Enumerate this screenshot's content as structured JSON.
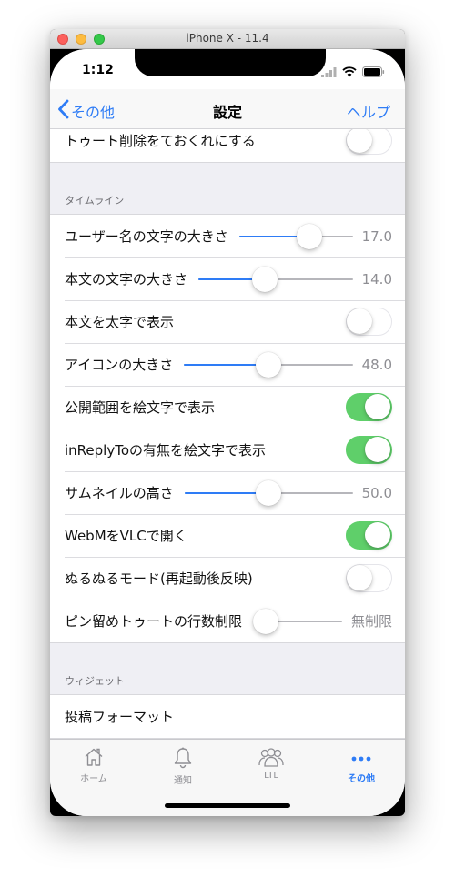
{
  "window": {
    "title": "iPhone X - 11.4"
  },
  "status": {
    "time": "1:12"
  },
  "nav": {
    "back_label": "その他",
    "title": "設定",
    "help_label": "ヘルプ"
  },
  "top_row": {
    "label": "トゥート削除をておくれにする",
    "on": false
  },
  "timeline": {
    "header": "タイムライン",
    "rows": [
      {
        "label": "ユーザー名の文字の大きさ",
        "type": "slider",
        "value": "17.0",
        "fraction": 0.65
      },
      {
        "label": "本文の文字の大きさ",
        "type": "slider",
        "value": "14.0",
        "fraction": 0.42
      },
      {
        "label": "本文を太字で表示",
        "type": "toggle",
        "on": false
      },
      {
        "label": "アイコンの大きさ",
        "type": "slider",
        "value": "48.0",
        "fraction": 0.5
      },
      {
        "label": "公開範囲を絵文字で表示",
        "type": "toggle",
        "on": true
      },
      {
        "label": "inReplyToの有無を絵文字で表示",
        "type": "toggle",
        "on": true
      },
      {
        "label": "サムネイルの高さ",
        "type": "slider",
        "value": "50.0",
        "fraction": 0.5
      },
      {
        "label": "WebMをVLCで開く",
        "type": "toggle",
        "on": true
      },
      {
        "label": "ぬるぬるモード(再起動後反映)",
        "type": "toggle",
        "on": false
      },
      {
        "label": "ピン留めトゥートの行数制限",
        "type": "slider",
        "value": "無制限",
        "fraction": 0.0
      }
    ]
  },
  "widget": {
    "header": "ウィジェット",
    "rows": [
      {
        "label": "投稿フォーマット"
      }
    ]
  },
  "tabbar": {
    "tabs": [
      {
        "label": "ホーム",
        "icon": "home-icon",
        "active": false
      },
      {
        "label": "通知",
        "icon": "bell-icon",
        "active": false
      },
      {
        "label": "LTL",
        "icon": "people-icon",
        "active": false
      },
      {
        "label": "その他",
        "icon": "more-icon",
        "active": true
      }
    ]
  },
  "colors": {
    "accent": "#2e7cf6",
    "toggle_on": "#5fcf6a"
  }
}
